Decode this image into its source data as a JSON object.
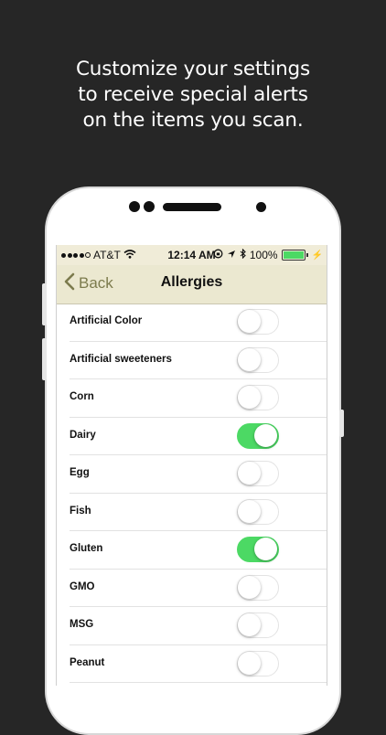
{
  "headline": [
    "Customize your settings",
    "to receive special alerts",
    "on the items you scan."
  ],
  "status_bar": {
    "carrier": "AT&T",
    "time": "12:14 AM",
    "battery": "100%"
  },
  "nav": {
    "back_label": "Back",
    "title": "Allergies"
  },
  "colors": {
    "toggle_on": "#4cd964",
    "nav_bg": "#ebe8d0",
    "back_tint": "#7c7b4d"
  },
  "items": [
    {
      "label": "Artificial Color",
      "on": false
    },
    {
      "label": "Artificial sweeteners",
      "on": false
    },
    {
      "label": "Corn",
      "on": false
    },
    {
      "label": "Dairy",
      "on": true
    },
    {
      "label": "Egg",
      "on": false
    },
    {
      "label": "Fish",
      "on": false
    },
    {
      "label": "Gluten",
      "on": true
    },
    {
      "label": "GMO",
      "on": false
    },
    {
      "label": "MSG",
      "on": false
    },
    {
      "label": "Peanut",
      "on": false
    }
  ]
}
